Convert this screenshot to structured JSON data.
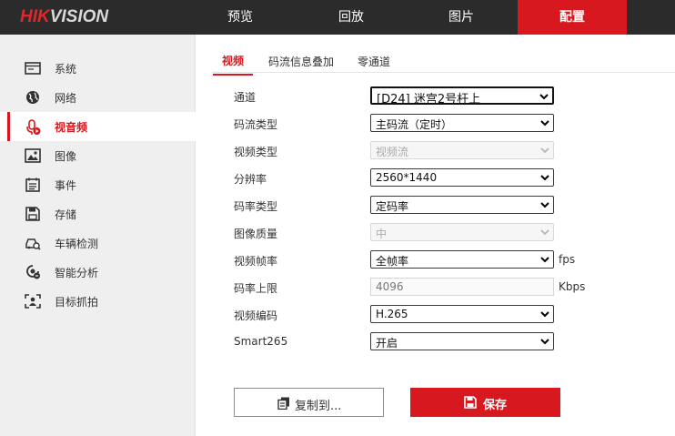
{
  "brand": {
    "logo_part1": "HIK",
    "logo_part2": "VISION"
  },
  "topnav": [
    {
      "label": "预览"
    },
    {
      "label": "回放"
    },
    {
      "label": "图片"
    },
    {
      "label": "配置",
      "active": true
    }
  ],
  "sidebar": {
    "items": [
      {
        "label": "系统",
        "icon": "system-icon"
      },
      {
        "label": "网络",
        "icon": "network-globe-icon"
      },
      {
        "label": "视音频",
        "icon": "microphone-video-icon",
        "active": true
      },
      {
        "label": "图像",
        "icon": "image-icon"
      },
      {
        "label": "事件",
        "icon": "event-list-icon"
      },
      {
        "label": "存储",
        "icon": "storage-disk-icon"
      },
      {
        "label": "车辆检测",
        "icon": "vehicle-detection-icon"
      },
      {
        "label": "智能分析",
        "icon": "smart-analysis-icon"
      },
      {
        "label": "目标抓拍",
        "icon": "target-capture-icon"
      }
    ]
  },
  "tabs": [
    {
      "label": "视频",
      "active": true
    },
    {
      "label": "码流信息叠加"
    },
    {
      "label": "零通道"
    }
  ],
  "form": {
    "channel": {
      "label": "通道",
      "value": "[D24] 迷宫2号杆上"
    },
    "stream_type": {
      "label": "码流类型",
      "value": "主码流（定时）"
    },
    "video_type": {
      "label": "视频类型",
      "value": "视频流",
      "disabled": true
    },
    "resolution": {
      "label": "分辨率",
      "value": "2560*1440"
    },
    "bitrate_type": {
      "label": "码率类型",
      "value": "定码率"
    },
    "image_quality": {
      "label": "图像质量",
      "value": "中",
      "disabled": true
    },
    "frame_rate": {
      "label": "视频帧率",
      "value": "全帧率",
      "unit": "fps"
    },
    "max_bitrate": {
      "label": "码率上限",
      "value": "4096",
      "unit": "Kbps"
    },
    "video_encoding": {
      "label": "视频编码",
      "value": "H.265"
    },
    "smart265": {
      "label": "Smart265",
      "value": "开启"
    }
  },
  "buttons": {
    "copy_label": "复制到...",
    "save_label": "保存"
  },
  "colors": {
    "accent": "#d7191f",
    "topbar": "#2b2b2b",
    "sidebar": "#efefef"
  }
}
